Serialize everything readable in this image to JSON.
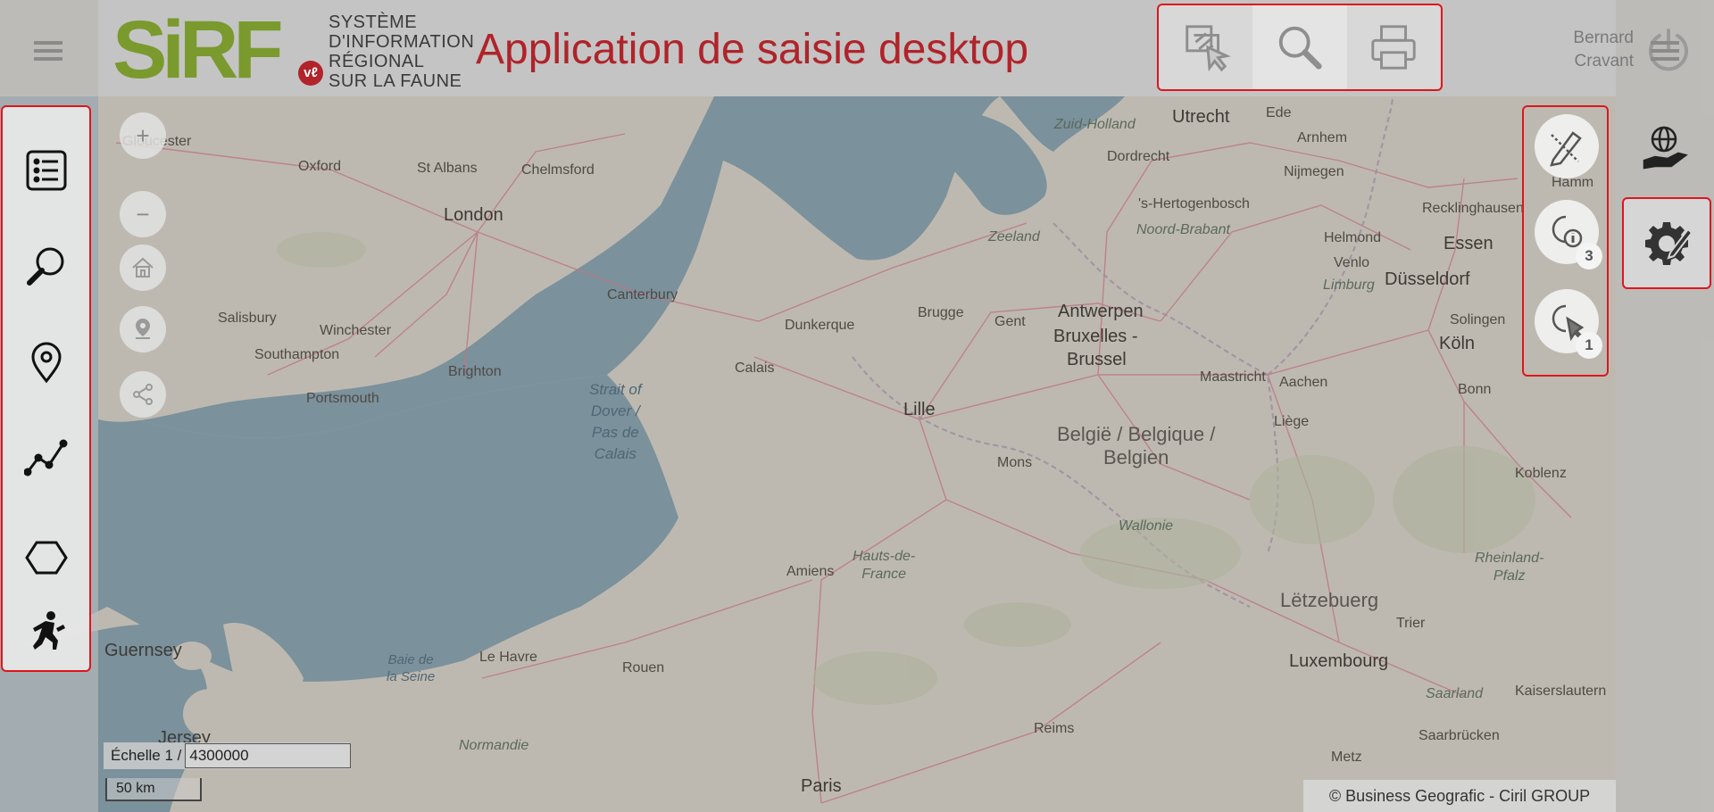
{
  "header": {
    "logo_word": "SiRF",
    "logo_badge": "vℓ",
    "logo_lines": [
      "SYSTÈME",
      "D'INFORMATION",
      "RÉGIONAL",
      "SUR LA FAUNE"
    ],
    "app_title": "Application de saisie desktop",
    "toolbar": [
      {
        "name": "layer-select-icon"
      },
      {
        "name": "search-icon"
      },
      {
        "name": "print-icon"
      }
    ],
    "user": {
      "first": "Bernard",
      "last": "Cravant"
    }
  },
  "left_tools": [
    {
      "name": "list-icon"
    },
    {
      "name": "search-icon"
    },
    {
      "name": "point-marker-icon"
    },
    {
      "name": "polyline-icon"
    },
    {
      "name": "polygon-icon"
    },
    {
      "name": "observer-icon"
    }
  ],
  "map_controls": {
    "zoom_in": "+",
    "zoom_out": "−"
  },
  "right_tools": [
    {
      "name": "draw-edit-icon",
      "badge": ""
    },
    {
      "name": "info-query-icon",
      "badge": "3"
    },
    {
      "name": "select-icon",
      "badge": "1"
    }
  ],
  "map": {
    "cities": [
      {
        "name": "Gloucester"
      },
      {
        "name": "Oxford"
      },
      {
        "name": "St Albans"
      },
      {
        "name": "Chelmsford"
      },
      {
        "name": "London"
      },
      {
        "name": "Canterbury"
      },
      {
        "name": "Salisbury"
      },
      {
        "name": "Winchester"
      },
      {
        "name": "Southampton"
      },
      {
        "name": "Brighton"
      },
      {
        "name": "Portsmouth"
      },
      {
        "name": "Dunkerque"
      },
      {
        "name": "Calais"
      },
      {
        "name": "Brugge"
      },
      {
        "name": "Gent"
      },
      {
        "name": "Antwerpen"
      },
      {
        "name": "Bruxelles -"
      },
      {
        "name": "Brussel"
      },
      {
        "name": "Lille"
      },
      {
        "name": "Mons"
      },
      {
        "name": "Maastricht"
      },
      {
        "name": "Aachen"
      },
      {
        "name": "Liège"
      },
      {
        "name": "Utrecht"
      },
      {
        "name": "Ede"
      },
      {
        "name": "Arnhem"
      },
      {
        "name": "Dordrecht"
      },
      {
        "name": "Nijmegen"
      },
      {
        "name": "'s-Hertogenbosch"
      },
      {
        "name": "Helmond"
      },
      {
        "name": "Venlo"
      },
      {
        "name": "Recklinghausen"
      },
      {
        "name": "Essen"
      },
      {
        "name": "Düsseldorf"
      },
      {
        "name": "Solingen"
      },
      {
        "name": "Köln"
      },
      {
        "name": "Bonn"
      },
      {
        "name": "Koblenz"
      },
      {
        "name": "Hamm"
      },
      {
        "name": "Amiens"
      },
      {
        "name": "Rouen"
      },
      {
        "name": "Le Havre"
      },
      {
        "name": "Reims"
      },
      {
        "name": "Paris"
      },
      {
        "name": "Metz"
      },
      {
        "name": "Trier"
      },
      {
        "name": "Luxembourg"
      },
      {
        "name": "Saarbrücken"
      },
      {
        "name": "Kaiserslautern"
      },
      {
        "name": "Guernsey"
      },
      {
        "name": "Jersey"
      }
    ],
    "seas": [
      "Strait of",
      "Dover /",
      "Pas de",
      "Calais",
      "Baie de",
      "la Seine"
    ],
    "regions": [
      "Zuid-Holland",
      "Zeeland",
      "Noord-Brabant",
      "Limburg",
      "Wallonie",
      "Hauts-de-",
      "France",
      "Normandie",
      "Rheinland-",
      "Pfalz",
      "Saarland"
    ],
    "countries": [
      "België / Belgique /",
      "Belgien",
      "Lëtzebuerg"
    ]
  },
  "scale": {
    "label": "Échelle 1 /",
    "value": "4300000",
    "bar_label": "50 km"
  },
  "attribution": "© Business Geografic - Ciril GROUP",
  "colors": {
    "title_red": "#b0232a",
    "highlight_border": "#e0151c",
    "logo_green": "#7a9a2e",
    "logo_teal": "#1f8fa3"
  }
}
